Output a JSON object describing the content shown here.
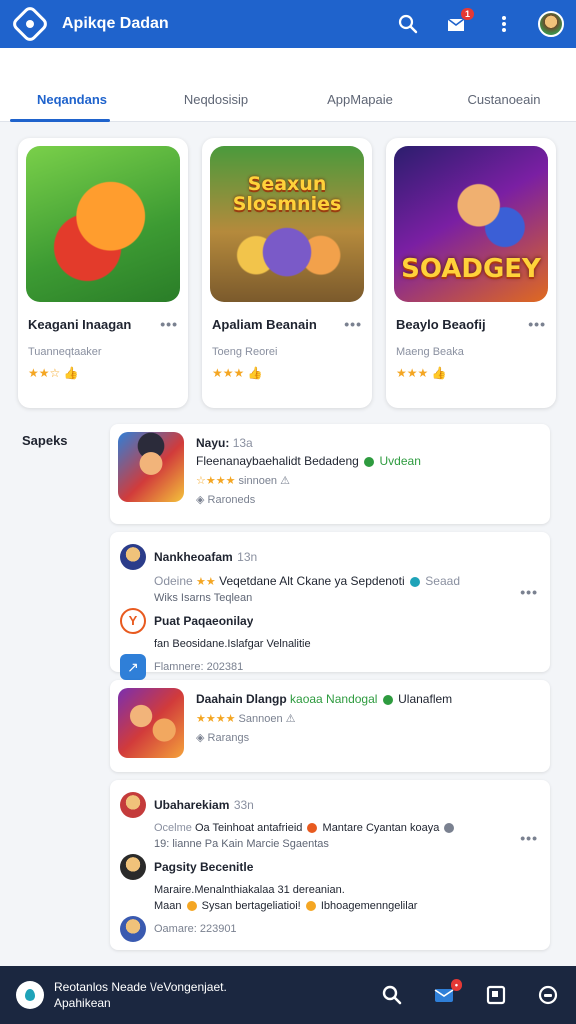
{
  "header": {
    "title": "Apikqe Dadan",
    "notification_count": "1"
  },
  "tabs": [
    {
      "label": "Neqandans",
      "active": true
    },
    {
      "label": "Neqdosisip",
      "active": false
    },
    {
      "label": "AppMapaie",
      "active": false
    },
    {
      "label": "Custanoeain",
      "active": false
    }
  ],
  "featured": [
    {
      "title": "Keagani Inaagan",
      "subtitle": "Tuanneqtaaker",
      "rating": "★★☆",
      "thumb_text": ""
    },
    {
      "title": "Apaliam Beanain",
      "subtitle": "Toeng Reorei",
      "rating": "★★★",
      "thumb_text": "Seaxun Slosmnies"
    },
    {
      "title": "Beaylo Beaofij",
      "subtitle": "Maeng Beaka",
      "rating": "★★★",
      "thumb_text": "SOADGEY"
    }
  ],
  "side_label": "Sapeks",
  "feed": {
    "post1": {
      "name": "Nayu:",
      "time": "13a",
      "line": "Fleenanaybaehalidt Bedadeng",
      "status": "Uvdean",
      "rating_text": "sinnoen",
      "meta": "Raroneds"
    },
    "post2": {
      "name": "Nankheoafam",
      "time": "13n",
      "line1": "Odeine",
      "line1b": "Veqetdane Alt Ckane ya Sepdenoti",
      "line1c": "Seaad",
      "line2": "Wiks",
      "line2b": "Isarns Teqlean",
      "line3": "Puat Paqaeonilay",
      "line4a": "fan",
      "line4b": "Beosidane.Islafgar Velnalitie",
      "footer": "Flamnere: 202381"
    },
    "post3": {
      "name": "Daahain Dlangp",
      "tag": "kaoaa Nandogal",
      "status": "Ulanaflem",
      "rating_text": "Sannoen",
      "meta": "Rarangs"
    },
    "post4": {
      "name": "Ubaharekiam",
      "time": "33n",
      "line1a": "Ocelme",
      "line1b": "Oa Teinhoat antafrieid",
      "line1c": "Mantare Cyantan koaya",
      "line2a": "19:",
      "line2b": "lianne Pa Kain",
      "line2c": "Marcie Sgaentas",
      "line3": "Pagsity Becenitle",
      "line4": "Maraire.Menalnthiakalaa 31 dereanian.",
      "line5a": "Maan",
      "line5b": "Sysan bertageliatioi!",
      "line5c": "Ibhoagemenngelilar",
      "footer": "Oamare: 223901"
    }
  },
  "bottombar": {
    "line1": "Reotanlos Neade \\/eVongenjaet.",
    "line2": "Apahikean"
  },
  "colors": {
    "accent": "#1f63cc",
    "bottom_bar": "#1b2740",
    "star": "#f4a623",
    "online": "#2e9b3f"
  }
}
